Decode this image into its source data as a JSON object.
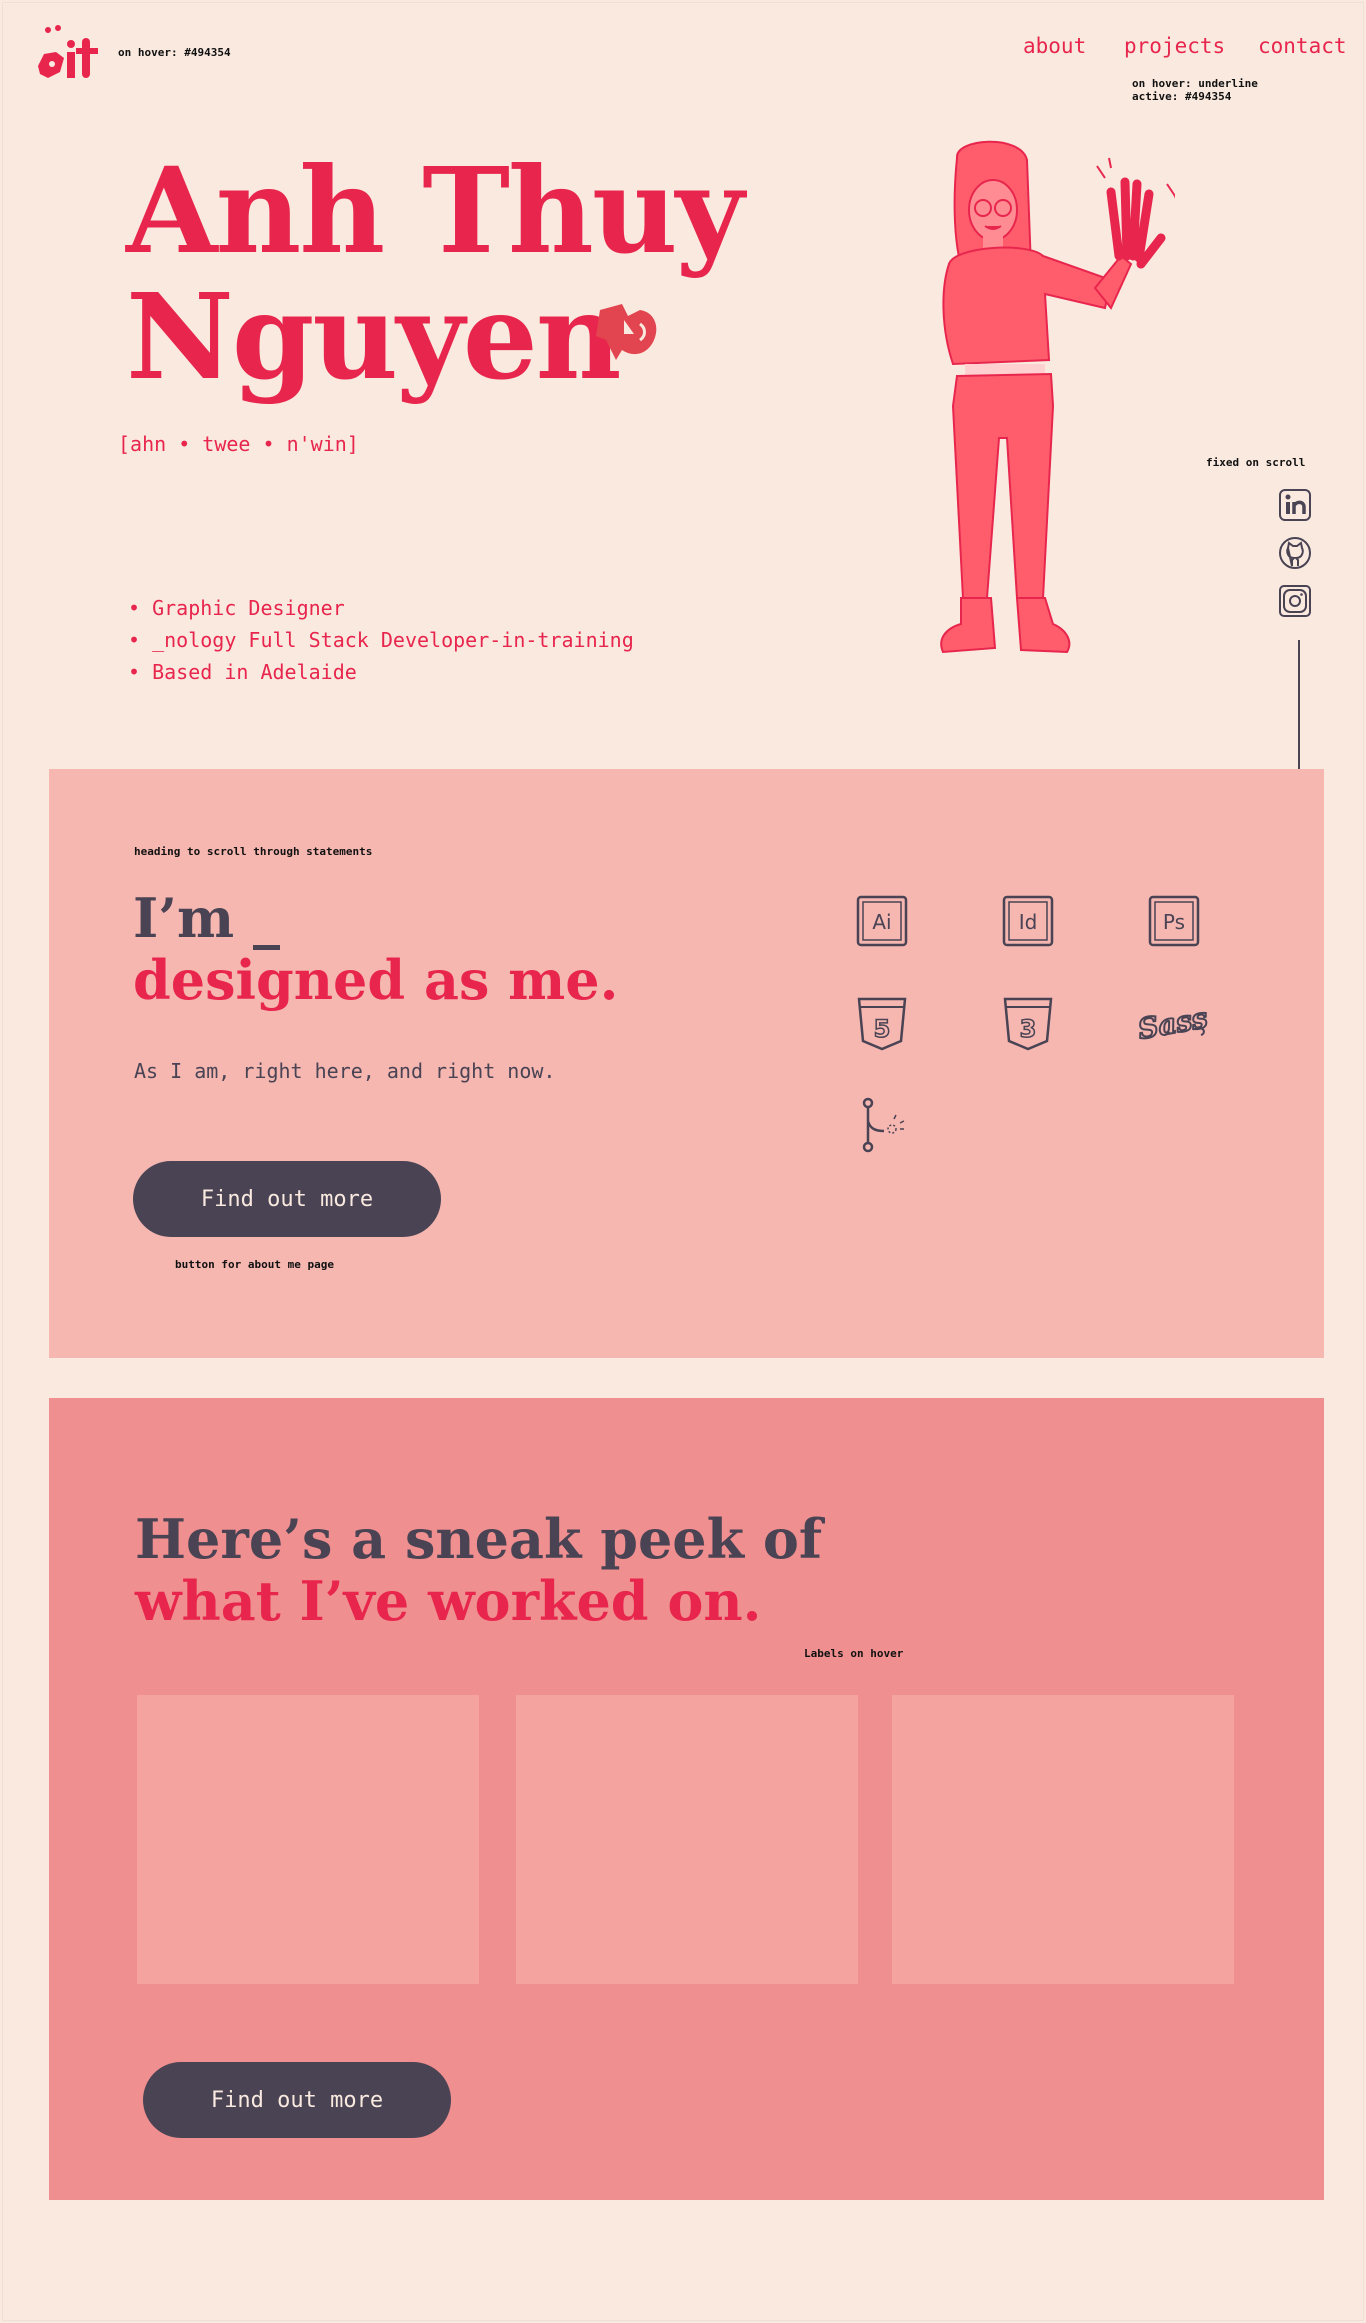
{
  "header": {
    "logo_text": "it",
    "logo_note": "on hover: #494354",
    "nav": [
      {
        "label": "about"
      },
      {
        "label": "projects"
      },
      {
        "label": "contact"
      }
    ],
    "nav_note_line1": "on hover: underline",
    "nav_note_line2": "active: #494354"
  },
  "hero": {
    "name_line1": "Anh Thuy",
    "name_line2": "Nguyen",
    "pronunciation": "[ahn • twee • n'win]",
    "bullets": [
      "Graphic Designer",
      "_nology Full Stack Developer-in-training",
      "Based in Adelaide"
    ]
  },
  "socials": {
    "note": "fixed on scroll",
    "items": [
      {
        "icon": "linkedin-icon"
      },
      {
        "icon": "github-icon"
      },
      {
        "icon": "instagram-icon"
      }
    ]
  },
  "skills": {
    "note": "heading to scroll through statements",
    "heading_line1": "I’m _",
    "heading_line2": "designed as me.",
    "subtext": "As I am, right here, and right now.",
    "button_label": "Find out more",
    "button_note": "button for about me page",
    "tools": [
      {
        "icon": "illustrator-icon",
        "label": "Ai"
      },
      {
        "icon": "indesign-icon",
        "label": "Id"
      },
      {
        "icon": "photoshop-icon",
        "label": "Ps"
      },
      {
        "icon": "html5-icon",
        "label": "5"
      },
      {
        "icon": "css3-icon",
        "label": "3"
      },
      {
        "icon": "sass-icon",
        "label": "Sass"
      },
      {
        "icon": "git-icon"
      }
    ]
  },
  "projects": {
    "heading_line1": "Here’s a sneak peek of",
    "heading_line2": "what I’ve worked on.",
    "labels_note": "Labels on hover",
    "button_label": "Find out more"
  },
  "colors": {
    "background": "#f9e9df",
    "accent": "#e8264d",
    "dark": "#494354",
    "skills_bg": "#f6b7b1",
    "projects_bg": "#f08f8f",
    "card": "#f4a39f"
  }
}
